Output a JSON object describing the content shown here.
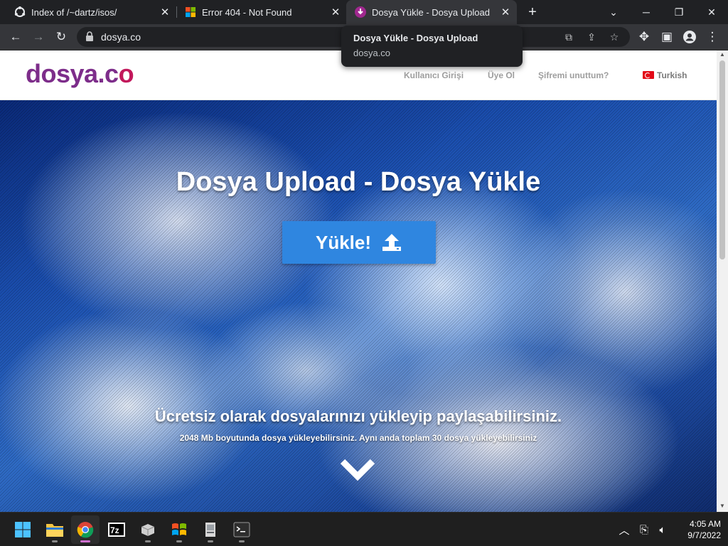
{
  "browser": {
    "tabs": [
      {
        "title": "Index of /~dartz/isos/",
        "favicon": "ubuntu-icon",
        "active": false
      },
      {
        "title": "Error 404 - Not Found",
        "favicon": "windows-logo-icon",
        "active": false
      },
      {
        "title": "Dosya Yükle - Dosya Upload",
        "favicon": "dosya-icon",
        "active": true
      }
    ],
    "url": "dosya.co",
    "tooltip": {
      "title": "Dosya Yükle - Dosya Upload",
      "domain": "dosya.co"
    }
  },
  "site": {
    "logo_main": "dosya.c",
    "logo_o": "o",
    "nav": {
      "login": "Kullanıcı Girişi",
      "register": "Üye Ol",
      "forgot": "Şifremi unuttum?",
      "language": "Turkish"
    },
    "hero": {
      "title": "Dosya Upload - Dosya Yükle",
      "upload_label": "Yükle!",
      "subtitle": "Ücretsiz olarak dosyalarınızı yükleyip paylaşabilirsiniz.",
      "note": "2048 Mb boyutunda dosya yükleyebilirsiniz. Aynı anda toplam 30 dosya yükleyebilirsiniz"
    },
    "colors": {
      "logo": "#7d2d8a",
      "button": "#2f86e0"
    }
  },
  "taskbar": {
    "apps": [
      "start-icon",
      "file-explorer-icon",
      "chrome-icon",
      "7zip-icon",
      "package-icon",
      "windows-xp-icon",
      "installer-icon",
      "terminal-icon"
    ],
    "time": "4:05 AM",
    "date": "9/7/2022"
  }
}
